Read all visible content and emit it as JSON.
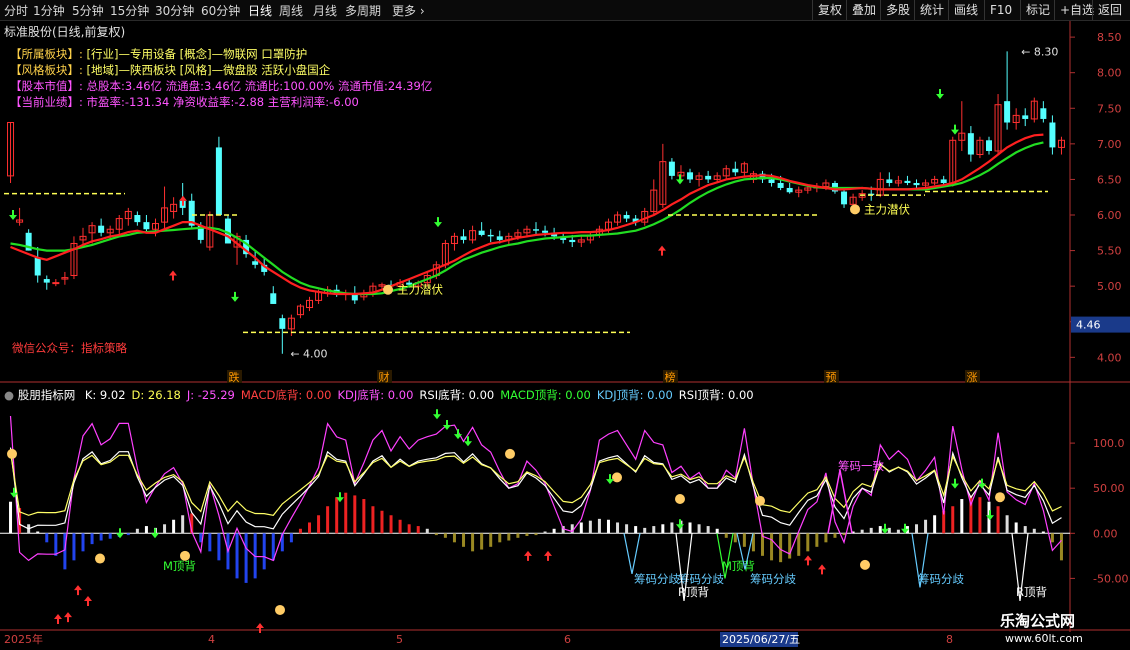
{
  "toolbar": {
    "periods": [
      {
        "label": "分时",
        "x": 4
      },
      {
        "label": "1分钟",
        "x": 33
      },
      {
        "label": "5分钟",
        "x": 72
      },
      {
        "label": "15分钟",
        "x": 110
      },
      {
        "label": "30分钟",
        "x": 155
      },
      {
        "label": "60分钟",
        "x": 201
      },
      {
        "label": "日线",
        "x": 248
      },
      {
        "label": "周线",
        "x": 279
      },
      {
        "label": "月线",
        "x": 313
      },
      {
        "label": "多周期",
        "x": 345
      },
      {
        "label": "更多",
        "x": 392
      }
    ],
    "more_glyph": "›",
    "right_buttons": [
      "复权",
      "叠加",
      "多股",
      "统计",
      "画线",
      "F10",
      "标记",
      "+自选",
      "返回"
    ]
  },
  "colors": {
    "up": "#ff3030",
    "down": "#54ffff",
    "ma_red": "#ff2020",
    "ma_green": "#22dd22",
    "yellow": "#ffff55",
    "magenta": "#ff40ff",
    "axis": "#b03030",
    "label_red": "#ff3c3c"
  },
  "info": {
    "stock_title": "标准股份(日线,前复权)",
    "lines": [
      {
        "key": "【所属板块】:",
        "val": "[行业]—专用设备 [概念]—物联网 口罩防护",
        "kc": "#ffd24a",
        "vc": "#ffff66"
      },
      {
        "key": "【风格板块】:",
        "val": "[地域]—陕西板块 [风格]—微盘股 活跃小盘国企",
        "kc": "#ffd24a",
        "vc": "#ffff66"
      },
      {
        "key": "【股本市值】:",
        "val": "总股本:3.46亿 流通盘:3.46亿 流通比:100.00% 流通市值:24.39亿",
        "kc": "#ff55ff",
        "vc": "#ff55ff"
      },
      {
        "key": "【当前业绩】:",
        "val": "市盈率:-131.34 净资收益率:-2.88 主营利润率:-6.00",
        "kc": "#ff55ff",
        "vc": "#ff55ff"
      }
    ],
    "wechat": "微信公众号：指标策略"
  },
  "annotations": {
    "high_label": "8.30",
    "low_label": "4.00",
    "zlqf": "主力潜伏",
    "events": [
      {
        "t": "跌",
        "x": 228
      },
      {
        "t": "财",
        "x": 378
      },
      {
        "t": "榜",
        "x": 664
      },
      {
        "t": "预",
        "x": 825
      },
      {
        "t": "涨",
        "x": 966
      }
    ]
  },
  "indicator": {
    "name": "股朋指标网",
    "values": [
      {
        "label": "K: 9.02",
        "color": "#ffffff"
      },
      {
        "label": "D: 26.18",
        "color": "#ffff55"
      },
      {
        "label": "J: -25.29",
        "color": "#ff55ff"
      },
      {
        "label": "MACD底背: 0.00",
        "color": "#ff4040"
      },
      {
        "label": "KDJ底背: 0.00",
        "color": "#ff55ff"
      },
      {
        "label": "RSI底背: 0.00",
        "color": "#ffffff"
      },
      {
        "label": "MACD顶背: 0.00",
        "color": "#33ff33"
      },
      {
        "label": "KDJ顶背: 0.00",
        "color": "#66ccff"
      },
      {
        "label": "RSI顶背: 0.00",
        "color": "#ffffff"
      }
    ],
    "texts": [
      {
        "t": "M顶背",
        "x": 163,
        "y": 570,
        "c": "#33ff33"
      },
      {
        "t": "M顶背",
        "x": 722,
        "y": 570,
        "c": "#33ff33"
      },
      {
        "t": "筹码一致",
        "x": 838,
        "y": 470,
        "c": "#ff55ff"
      },
      {
        "t": "筹码分歧",
        "x": 634,
        "y": 583,
        "c": "#66ccff"
      },
      {
        "t": "筹码分歧",
        "x": 678,
        "y": 583,
        "c": "#66ccff"
      },
      {
        "t": "筹码分歧",
        "x": 750,
        "y": 583,
        "c": "#66ccff"
      },
      {
        "t": "筹码分歧",
        "x": 918,
        "y": 583,
        "c": "#66ccff"
      },
      {
        "t": "R顶背",
        "x": 678,
        "y": 596,
        "c": "#ffffff"
      },
      {
        "t": "R顶背",
        "x": 1016,
        "y": 596,
        "c": "#ffffff"
      }
    ]
  },
  "dates": {
    "labels": [
      {
        "t": "2025年",
        "x": 4
      },
      {
        "t": "4",
        "x": 208
      },
      {
        "t": "5",
        "x": 396
      },
      {
        "t": "6",
        "x": 564
      },
      {
        "t": "8",
        "x": 946
      }
    ],
    "cursor": "2025/06/27/五"
  },
  "watermark": {
    "name": "乐淘公式网",
    "url": "www.60lt.com"
  },
  "chart_data": [
    {
      "type": "candlestick",
      "title": "标准股份(日线,前复权)",
      "ylim": [
        3.85,
        8.6
      ],
      "yticks": [
        4.0,
        4.5,
        5.0,
        5.5,
        6.0,
        6.5,
        7.0,
        7.5,
        8.0,
        8.5
      ],
      "ytick_labels": [
        "4.00",
        "4.50",
        "5.00",
        "5.50",
        "6.00",
        "6.50",
        "7.00",
        "7.50",
        "8.00",
        "8.50"
      ],
      "current_price": "4.46",
      "high": 8.3,
      "low": 4.0,
      "bars_ohlc": [
        [
          6.55,
          7.3,
          6.45,
          7.3
        ],
        [
          5.9,
          6.1,
          5.85,
          5.93
        ],
        [
          5.75,
          5.8,
          5.5,
          5.5
        ],
        [
          5.4,
          5.55,
          5.05,
          5.15
        ],
        [
          5.1,
          5.15,
          4.95,
          5.05
        ],
        [
          5.05,
          5.1,
          5.0,
          5.05
        ],
        [
          5.1,
          5.2,
          5.02,
          5.12
        ],
        [
          5.15,
          5.7,
          5.1,
          5.6
        ],
        [
          5.65,
          5.82,
          5.55,
          5.7
        ],
        [
          5.75,
          5.9,
          5.6,
          5.85
        ],
        [
          5.85,
          5.95,
          5.7,
          5.75
        ],
        [
          5.75,
          5.85,
          5.65,
          5.8
        ],
        [
          5.8,
          6.0,
          5.7,
          5.95
        ],
        [
          5.95,
          6.1,
          5.85,
          6.05
        ],
        [
          6.0,
          6.05,
          5.85,
          5.9
        ],
        [
          5.9,
          6.0,
          5.75,
          5.8
        ],
        [
          5.8,
          5.95,
          5.7,
          5.88
        ],
        [
          5.9,
          6.4,
          5.8,
          6.1
        ],
        [
          6.05,
          6.25,
          5.95,
          6.15
        ],
        [
          6.2,
          6.45,
          6.0,
          6.1
        ],
        [
          6.2,
          6.3,
          5.8,
          5.85
        ],
        [
          5.85,
          5.9,
          5.6,
          5.65
        ],
        [
          5.55,
          6.05,
          5.5,
          6.0
        ],
        [
          6.95,
          7.1,
          6.0,
          6.0
        ],
        [
          5.95,
          6.0,
          5.6,
          5.6
        ],
        [
          5.55,
          5.75,
          5.3,
          5.7
        ],
        [
          5.65,
          5.72,
          5.4,
          5.45
        ],
        [
          5.35,
          5.5,
          5.25,
          5.3
        ],
        [
          5.3,
          5.4,
          5.15,
          5.2
        ],
        [
          4.9,
          5.0,
          4.75,
          4.75
        ],
        [
          4.55,
          4.6,
          4.05,
          4.4
        ],
        [
          4.4,
          4.6,
          4.3,
          4.55
        ],
        [
          4.6,
          4.75,
          4.55,
          4.72
        ],
        [
          4.7,
          4.85,
          4.65,
          4.8
        ],
        [
          4.8,
          4.95,
          4.75,
          4.92
        ],
        [
          4.9,
          5.0,
          4.85,
          4.95
        ],
        [
          4.95,
          5.02,
          4.85,
          4.88
        ],
        [
          4.9,
          4.95,
          4.8,
          4.9
        ],
        [
          4.9,
          5.0,
          4.75,
          4.8
        ],
        [
          4.85,
          4.95,
          4.8,
          4.9
        ],
        [
          4.9,
          5.05,
          4.85,
          5.0
        ],
        [
          5.0,
          5.05,
          4.95,
          5.02
        ],
        [
          5.02,
          5.08,
          4.95,
          5.0
        ],
        [
          5.0,
          5.1,
          4.95,
          5.05
        ],
        [
          5.05,
          5.1,
          4.98,
          5.02
        ],
        [
          5.0,
          5.08,
          4.95,
          5.05
        ],
        [
          5.05,
          5.2,
          5.0,
          5.15
        ],
        [
          5.15,
          5.35,
          5.1,
          5.3
        ],
        [
          5.3,
          5.65,
          5.25,
          5.6
        ],
        [
          5.6,
          5.75,
          5.5,
          5.7
        ],
        [
          5.7,
          5.8,
          5.6,
          5.65
        ],
        [
          5.65,
          5.85,
          5.6,
          5.78
        ],
        [
          5.78,
          5.9,
          5.7,
          5.72
        ],
        [
          5.72,
          5.8,
          5.62,
          5.7
        ],
        [
          5.7,
          5.78,
          5.6,
          5.65
        ],
        [
          5.65,
          5.75,
          5.58,
          5.7
        ],
        [
          5.7,
          5.8,
          5.65,
          5.75
        ],
        [
          5.75,
          5.85,
          5.7,
          5.8
        ],
        [
          5.8,
          5.9,
          5.72,
          5.78
        ],
        [
          5.78,
          5.85,
          5.7,
          5.75
        ],
        [
          5.75,
          5.82,
          5.65,
          5.7
        ],
        [
          5.7,
          5.75,
          5.6,
          5.65
        ],
        [
          5.65,
          5.72,
          5.55,
          5.62
        ],
        [
          5.62,
          5.7,
          5.55,
          5.65
        ],
        [
          5.65,
          5.75,
          5.6,
          5.72
        ],
        [
          5.72,
          5.85,
          5.68,
          5.8
        ],
        [
          5.8,
          5.95,
          5.75,
          5.9
        ],
        [
          5.9,
          6.05,
          5.85,
          6.0
        ],
        [
          6.0,
          6.05,
          5.9,
          5.95
        ],
        [
          5.95,
          6.0,
          5.85,
          5.9
        ],
        [
          5.9,
          6.1,
          5.85,
          6.05
        ],
        [
          6.05,
          6.5,
          6.0,
          6.35
        ],
        [
          6.15,
          7.0,
          6.1,
          6.75
        ],
        [
          6.75,
          6.8,
          6.5,
          6.55
        ],
        [
          6.55,
          6.7,
          6.45,
          6.6
        ],
        [
          6.6,
          6.65,
          6.45,
          6.5
        ],
        [
          6.5,
          6.6,
          6.4,
          6.55
        ],
        [
          6.55,
          6.62,
          6.45,
          6.5
        ],
        [
          6.5,
          6.6,
          6.45,
          6.55
        ],
        [
          6.55,
          6.7,
          6.5,
          6.65
        ],
        [
          6.65,
          6.75,
          6.55,
          6.6
        ],
        [
          6.6,
          6.75,
          6.55,
          6.72
        ],
        [
          6.5,
          6.62,
          6.45,
          6.58
        ],
        [
          6.58,
          6.62,
          6.45,
          6.5
        ],
        [
          6.5,
          6.58,
          6.4,
          6.45
        ],
        [
          6.45,
          6.55,
          6.35,
          6.38
        ],
        [
          6.38,
          6.45,
          6.3,
          6.32
        ],
        [
          6.32,
          6.4,
          6.25,
          6.35
        ],
        [
          6.35,
          6.42,
          6.3,
          6.38
        ],
        [
          6.38,
          6.45,
          6.32,
          6.4
        ],
        [
          6.4,
          6.5,
          6.35,
          6.45
        ],
        [
          6.45,
          6.48,
          6.3,
          6.33
        ],
        [
          6.33,
          6.38,
          6.1,
          6.15
        ],
        [
          6.15,
          6.3,
          6.1,
          6.25
        ],
        [
          6.25,
          6.35,
          6.2,
          6.3
        ],
        [
          6.3,
          6.4,
          6.2,
          6.28
        ],
        [
          6.28,
          6.6,
          6.25,
          6.5
        ],
        [
          6.5,
          6.6,
          6.4,
          6.45
        ],
        [
          6.45,
          6.55,
          6.4,
          6.48
        ],
        [
          6.48,
          6.55,
          6.42,
          6.45
        ],
        [
          6.45,
          6.5,
          6.38,
          6.42
        ],
        [
          6.42,
          6.5,
          6.38,
          6.45
        ],
        [
          6.45,
          6.55,
          6.42,
          6.5
        ],
        [
          6.5,
          6.55,
          6.42,
          6.45
        ],
        [
          6.45,
          7.1,
          6.4,
          7.05
        ],
        [
          7.05,
          7.6,
          6.9,
          7.15
        ],
        [
          7.15,
          7.25,
          6.75,
          6.85
        ],
        [
          6.85,
          7.1,
          6.8,
          7.05
        ],
        [
          7.05,
          7.1,
          6.85,
          6.9
        ],
        [
          6.9,
          7.7,
          6.85,
          7.55
        ],
        [
          7.6,
          8.3,
          7.2,
          7.3
        ],
        [
          7.3,
          7.5,
          7.2,
          7.4
        ],
        [
          7.4,
          7.5,
          7.25,
          7.35
        ],
        [
          7.35,
          7.65,
          7.3,
          7.6
        ],
        [
          7.5,
          7.6,
          7.3,
          7.35
        ],
        [
          7.3,
          7.4,
          6.85,
          6.95
        ],
        [
          6.95,
          7.1,
          6.85,
          7.05
        ]
      ],
      "ma_red": [
        5.55,
        5.5,
        5.45,
        5.4,
        5.37,
        5.42,
        5.47,
        5.52,
        5.58,
        5.63,
        5.66,
        5.7,
        5.72,
        5.76,
        5.78,
        5.75,
        5.75,
        5.8,
        5.85,
        5.9,
        5.9,
        5.85,
        5.8,
        5.75,
        5.7,
        5.6,
        5.5,
        5.4,
        5.28,
        5.2,
        5.12,
        5.04,
        4.98,
        4.94,
        4.92,
        4.9,
        4.89,
        4.89,
        4.89,
        4.9,
        4.91,
        4.95,
        5.0,
        5.05,
        5.1,
        5.15,
        5.2,
        5.25,
        5.3,
        5.36,
        5.43,
        5.5,
        5.55,
        5.6,
        5.62,
        5.65,
        5.68,
        5.7,
        5.72,
        5.73,
        5.74,
        5.75,
        5.75,
        5.76,
        5.76,
        5.77,
        5.79,
        5.82,
        5.86,
        5.9,
        5.95,
        6.0,
        6.07,
        6.15,
        6.22,
        6.3,
        6.36,
        6.42,
        6.46,
        6.5,
        6.52,
        6.54,
        6.55,
        6.56,
        6.55,
        6.52,
        6.48,
        6.45,
        6.42,
        6.4,
        6.38,
        6.36,
        6.36,
        6.37,
        6.38,
        6.37,
        6.36,
        6.36,
        6.36,
        6.36,
        6.37,
        6.38,
        6.4,
        6.42,
        6.45,
        6.5,
        6.58,
        6.66,
        6.75,
        6.85,
        6.95,
        7.02,
        7.08,
        7.12,
        7.13
      ],
      "ma_green": [
        5.6,
        5.58,
        5.55,
        5.52,
        5.5,
        5.5,
        5.5,
        5.52,
        5.55,
        5.58,
        5.62,
        5.66,
        5.7,
        5.72,
        5.75,
        5.76,
        5.77,
        5.78,
        5.79,
        5.8,
        5.81,
        5.82,
        5.82,
        5.8,
        5.75,
        5.68,
        5.6,
        5.5,
        5.4,
        5.3,
        5.2,
        5.12,
        5.05,
        5.0,
        4.97,
        4.94,
        4.92,
        4.9,
        4.89,
        4.89,
        4.89,
        4.9,
        4.93,
        4.96,
        5.0,
        5.05,
        5.1,
        5.15,
        5.22,
        5.3,
        5.37,
        5.42,
        5.47,
        5.51,
        5.55,
        5.58,
        5.6,
        5.63,
        5.65,
        5.67,
        5.68,
        5.69,
        5.7,
        5.71,
        5.71,
        5.72,
        5.73,
        5.74,
        5.76,
        5.78,
        5.82,
        5.87,
        5.93,
        6.0,
        6.08,
        6.17,
        6.25,
        6.32,
        6.38,
        6.43,
        6.47,
        6.5,
        6.51,
        6.52,
        6.52,
        6.5,
        6.47,
        6.44,
        6.41,
        6.39,
        6.38,
        6.38,
        6.38,
        6.38,
        6.38,
        6.37,
        6.36,
        6.36,
        6.36,
        6.36,
        6.36,
        6.36,
        6.38,
        6.4,
        6.42,
        6.45,
        6.5,
        6.56,
        6.63,
        6.72,
        6.8,
        6.88,
        6.94,
        6.99,
        7.02
      ]
    },
    {
      "type": "bar",
      "title": "股朋指标网",
      "ylim": [
        -105,
        150
      ],
      "yticks": [
        100,
        50,
        0,
        -50
      ],
      "ytick_labels": [
        "100.0",
        "50.00",
        "0.00",
        "-50.00"
      ],
      "macd_bars": [
        35,
        28,
        10,
        2,
        -10,
        -25,
        -40,
        -30,
        -20,
        -12,
        -8,
        -6,
        -4,
        -2,
        5,
        8,
        6,
        10,
        15,
        20,
        22,
        -10,
        -20,
        -30,
        -40,
        -50,
        -55,
        -50,
        -40,
        -30,
        -20,
        -10,
        5,
        12,
        20,
        30,
        40,
        45,
        42,
        38,
        30,
        25,
        20,
        15,
        10,
        8,
        5,
        -2,
        -5,
        -10,
        -15,
        -20,
        -18,
        -15,
        -10,
        -8,
        -5,
        -3,
        -2,
        2,
        5,
        8,
        10,
        12,
        14,
        16,
        15,
        12,
        10,
        8,
        6,
        8,
        10,
        12,
        14,
        12,
        10,
        8,
        5,
        -5,
        -10,
        -15,
        -20,
        -25,
        -30,
        -32,
        -28,
        -25,
        -20,
        -15,
        -10,
        -5,
        -2,
        2,
        4,
        6,
        8,
        6,
        4,
        8,
        10,
        15,
        20,
        25,
        30,
        38,
        42,
        40,
        35,
        30,
        20,
        12,
        8,
        5,
        2,
        -10,
        -30
      ]
    }
  ]
}
